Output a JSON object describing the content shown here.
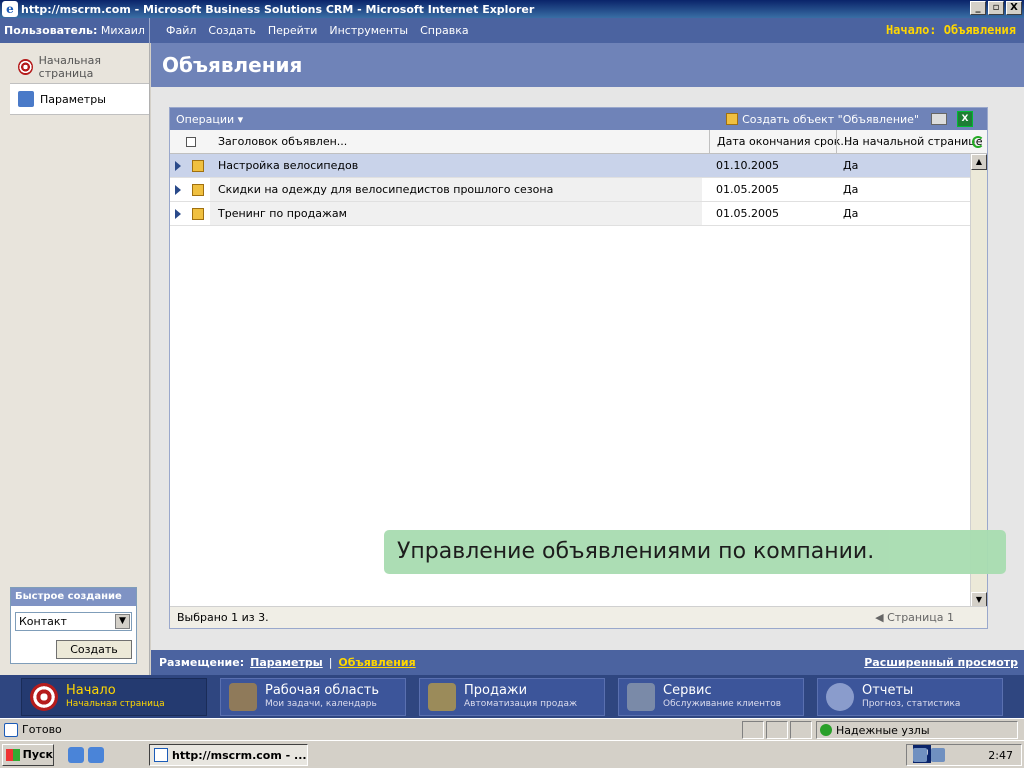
{
  "window": {
    "title": "http://mscrm.com - Microsoft Business Solutions CRM - Microsoft Internet Explorer",
    "buttons": [
      "_",
      "▫",
      "X"
    ]
  },
  "crmbar": {
    "user_label": "Пользователь:",
    "user_name": "Михаил ...",
    "menu": [
      "Файл",
      "Создать",
      "Перейти",
      "Инструменты",
      "Справка"
    ],
    "home": "Начало: Объявления"
  },
  "leftnav": {
    "items": [
      {
        "label": "Начальная страница",
        "icon": "target-icon"
      },
      {
        "label": "Параметры",
        "icon": "settings-icon"
      }
    ],
    "quick_create": {
      "title": "Быстрое создание",
      "selected": "Контакт",
      "button": "Создать"
    }
  },
  "page": {
    "title": "Объявления"
  },
  "grid": {
    "operations": "Операции",
    "create_label": "Создать объект \"Объявление\"",
    "columns": [
      "Заголовок объявлен...",
      "Дата окончания срок...",
      "На начальной странице"
    ],
    "rows": [
      {
        "title": "Настройка велосипедов",
        "date": "01.10.2005",
        "home": "Да"
      },
      {
        "title": "Скидки на одежду для велосипедистов прошлого сезона",
        "date": "01.05.2005",
        "home": "Да"
      },
      {
        "title": "Тренинг по продажам",
        "date": "01.05.2005",
        "home": "Да"
      }
    ],
    "footer_selected": "Выбрано 1 из 3.",
    "footer_page": "Страница 1"
  },
  "toast": "Управление объявлениями по компании.",
  "breadcrumb": {
    "label": "Размещение:",
    "items": [
      "Параметры",
      "Объявления"
    ],
    "sep": "|",
    "advanced": "Расширенный просмотр"
  },
  "bottomnav": [
    {
      "title": "Начало",
      "sub": "Начальная страница"
    },
    {
      "title": "Рабочая область",
      "sub": "Мои задачи, календарь"
    },
    {
      "title": "Продажи",
      "sub": "Автоматизация продаж"
    },
    {
      "title": "Сервис",
      "sub": "Обслуживание клиентов"
    },
    {
      "title": "Отчеты",
      "sub": "Прогноз, статистика"
    }
  ],
  "statusbar": {
    "status": "Готово",
    "zone": "Надежные узлы"
  },
  "taskbar": {
    "start": "Пуск",
    "task": "http://mscrm.com - ...",
    "lang": "RU",
    "clock": "2:47"
  },
  "colors": {
    "accent": "#4b63a0",
    "header": "#6f83b8",
    "highlight": "#ffd700",
    "toast": "#a8dcb0"
  }
}
